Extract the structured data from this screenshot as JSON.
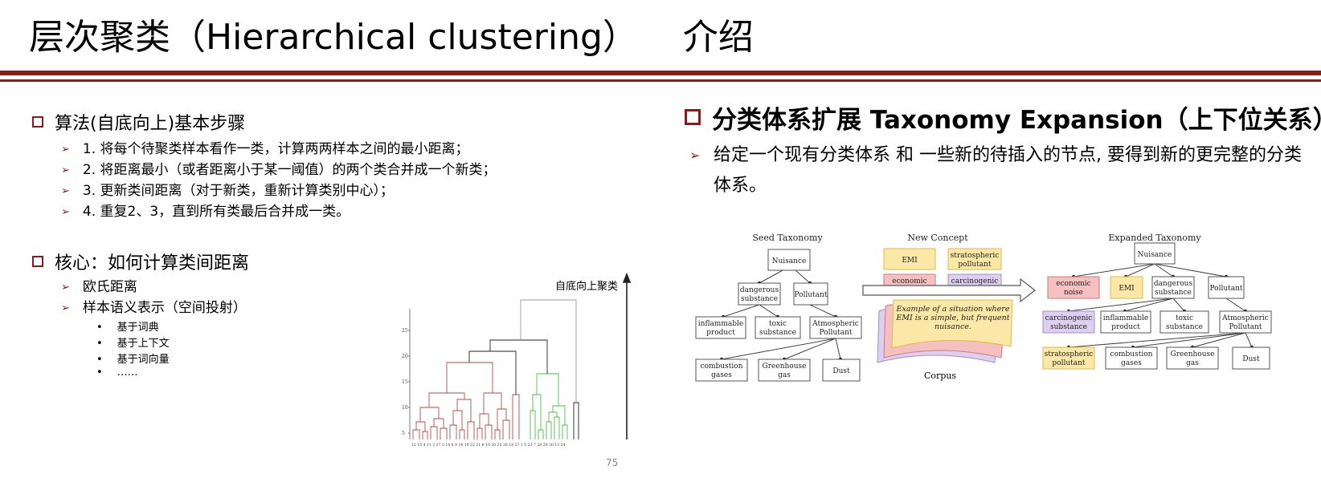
{
  "title": "层次聚类（Hierarchical clustering）    介绍",
  "left": {
    "section1": {
      "heading": "算法(自底向上)基本步骤",
      "steps": [
        "1. 将每个待聚类样本看作一类，计算两两样本之间的最小距离；",
        "2. 将距离最小（或者距离小于某一阈值）的两个类合并成一个新类；",
        "3. 更新类间距离（对于新类，重新计算类别中心）；",
        "4. 重复2、3，直到所有类最后合并成一类。"
      ]
    },
    "section2": {
      "heading": "核心：如何计算类间距离",
      "items": [
        "欧氏距离",
        "样本语义表示（空间投射）"
      ],
      "subitems": [
        "基于词典",
        "基于上下文",
        "基于词向量",
        "……"
      ]
    }
  },
  "dendrogram": {
    "arrow_label": "自底向上聚类",
    "yticks": [
      "25",
      "20",
      "15",
      "10",
      "5"
    ],
    "xticks": "12 15  4 11  2 17  3 14  6  9 16 19 22 21  8 10 20 25 26 18 27  1  5 23  7 28 29 30 13 24"
  },
  "right": {
    "heading": "分类体系扩展 Taxonomy Expansion（上下位关系）",
    "bullet": "给定一个现有分类体系 和 一些新的待插入的节点, 要得到新的更完整的分类体系。"
  },
  "taxonomy": {
    "seed_title": "Seed Taxonomy",
    "new_title": "New Concept",
    "expanded_title": "Expanded Taxonomy",
    "corpus_label": "Corpus",
    "corpus_text": [
      "Example of a situation where",
      "EMI is a simple, but frequent",
      "nuisance."
    ],
    "seed_nodes": {
      "nuisance": "Nuisance",
      "dangerous": [
        "dangerous",
        "substance"
      ],
      "pollutant": "Pollutant",
      "inflammable": [
        "inflammable",
        "product"
      ],
      "toxic": [
        "toxic",
        "substance"
      ],
      "atmospheric": [
        "Atmospheric",
        "Pollutant"
      ],
      "combustion": [
        "combustion",
        "gases"
      ],
      "greenhouse": [
        "Greenhouse",
        "gas"
      ],
      "dust": "Dust"
    },
    "new_nodes": {
      "emi": "EMI",
      "stratospheric": [
        "stratospheric",
        "pollutant"
      ],
      "economic": [
        "economic",
        "noise"
      ],
      "carcinogenic": [
        "carcinogenic",
        "substance"
      ]
    },
    "colors": {
      "yellow_fill": "#fbe7a6",
      "yellow_stroke": "#e0b84a",
      "red_fill": "#f6c0c0",
      "red_stroke": "#d07a7a",
      "purple_fill": "#dccff0",
      "purple_stroke": "#a58cc8"
    }
  },
  "page_number": "75"
}
